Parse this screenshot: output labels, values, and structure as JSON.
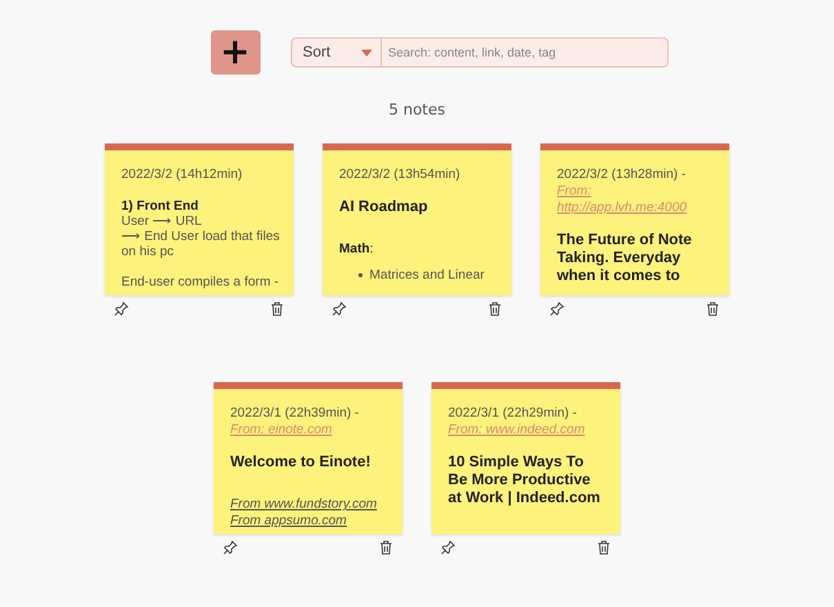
{
  "toolbar": {
    "add_button": "+",
    "sort": {
      "label": "Sort"
    },
    "search": {
      "placeholder": "Search: content, link, date, tag"
    }
  },
  "count": "5 notes",
  "notes": [
    {
      "date": "2022/3/2 (14h12min)",
      "blocks": [
        {
          "kind": "heading",
          "text": "1) Front End"
        },
        {
          "kind": "text",
          "text": "User ⟶ URL"
        },
        {
          "kind": "text",
          "text": "⟶ End User load that files on his pc"
        },
        {
          "kind": "spaced",
          "text": "End-user compiles a form -"
        }
      ]
    },
    {
      "date": "2022/3/2 (13h54min)",
      "blocks": [
        {
          "kind": "title",
          "text": "AI Roadmap"
        },
        {
          "kind": "label",
          "text": "**Math**:"
        },
        {
          "kind": "bullet",
          "text": "Matrices and Linear"
        }
      ]
    },
    {
      "date": "2022/3/2 (13h28min) -",
      "source": "From: http://app.lvh.me:4000",
      "blocks": [
        {
          "kind": "title",
          "text": "The Future of Note Taking. Everyday when it comes to"
        }
      ]
    },
    {
      "date": "2022/3/1 (22h39min) -",
      "source": "From: einote.com",
      "blocks": [
        {
          "kind": "title",
          "text": "Welcome to Einote!"
        },
        {
          "kind": "link",
          "text": "From www.fundstory.com"
        },
        {
          "kind": "link",
          "text": "From appsumo.com"
        }
      ]
    },
    {
      "date": "2022/3/1 (22h29min) -",
      "source": "From: www.indeed.com",
      "blocks": [
        {
          "kind": "title",
          "text": "10 Simple Ways To Be More Productive at Work | Indeed.com"
        }
      ]
    }
  ]
}
